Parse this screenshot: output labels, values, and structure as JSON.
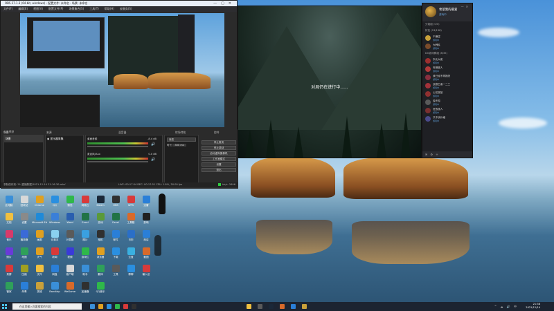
{
  "obs": {
    "title": "OBS 27.1.3 (64-bit, windows) - 配置文件: 未命名 - 场景: 未命名",
    "menu": [
      "文件(F)",
      "编辑(E)",
      "视图(V)",
      "配置文件(P)",
      "场景集合(S)",
      "工具(T)",
      "帮助(H)",
      "云服务(S)"
    ],
    "docks": {
      "scenes": "场景",
      "sources": "来源",
      "mixer": "混音器",
      "transitions": "转场特效",
      "controls": "控件"
    },
    "scene_item": "场景",
    "source_item": "显示器采集",
    "preview_label": "未选择源",
    "mixer_tracks": [
      {
        "name": "桌面音频",
        "db": "-8.4 dB"
      },
      {
        "name": "麦克风/Aux",
        "db": "0.0 dB"
      }
    ],
    "transition": {
      "type": "渐变",
      "duration_label": "时长",
      "duration": "300 ms"
    },
    "controls": [
      "停止推流",
      "停止录制",
      "启动虚拟摄像机",
      "工作室模式",
      "设置",
      "退出"
    ],
    "status": "录制保存到: 'D:/直播数据/2021-12-14 21-16-30.mkv'",
    "status_live": "LIVE: 00:17:54  REC: 00:17:51  CPU: 1.8%, 30.00 fps",
    "status_kbps": "kb/s: 2696"
  },
  "game": {
    "message": "对局仍在进行中......"
  },
  "chat": {
    "name": "希望我的最爱",
    "sub": "游戏中",
    "sections": [
      {
        "label": "分组组 (0/0)"
      },
      {
        "label": "好友 (13/138)"
      },
      {
        "label": "DG游戏群组 (8/35)"
      }
    ],
    "users": [
      {
        "name": "干燥涩",
        "status": "游戏中",
        "color": "#c8a03a"
      },
      {
        "name": "大韩民",
        "status": "游戏中",
        "color": "#7a4b2a"
      },
      {
        "name": "东北大佬",
        "status": "游戏中",
        "color": "#9c2f2f"
      },
      {
        "name": "炸弹超人",
        "status": "游戏中",
        "color": "#b03a3a"
      },
      {
        "name": "我已经不再抱怨",
        "status": "游戏中",
        "color": "#8a2f3f"
      },
      {
        "name": "战狼王者一二三",
        "status": "游戏中",
        "color": "#a2323a"
      },
      {
        "name": "心花怒放",
        "status": "游戏中",
        "color": "#903030"
      },
      {
        "name": "独不孤",
        "status": "游戏中",
        "color": "#5a5a5a"
      },
      {
        "name": "狂放旅人",
        "status": "游戏中",
        "color": "#7a3030"
      },
      {
        "name": "只不谈价格",
        "status": "游戏中",
        "color": "#4a4a8a"
      }
    ]
  },
  "desktop_icons": [
    {
      "label": "此电脑",
      "color": "#3a8fd8"
    },
    {
      "label": "回收站",
      "color": "#d8d8d8"
    },
    {
      "label": "Chrome",
      "color": "#e0a020"
    },
    {
      "label": "QQ",
      "color": "#2a8fe0"
    },
    {
      "label": "微信",
      "color": "#2fb84a"
    },
    {
      "label": "网易云",
      "color": "#d83a3a"
    },
    {
      "label": "Steam",
      "color": "#1b2838"
    },
    {
      "label": "OBS",
      "color": "#303030"
    },
    {
      "label": "WPS",
      "color": "#d83a3a"
    },
    {
      "label": "迅雷",
      "color": "#2a7fd8"
    },
    {
      "label": "文档",
      "color": "#f0c040"
    },
    {
      "label": "设置",
      "color": "#8a8a8a"
    },
    {
      "label": "Microsoft Edge",
      "color": "#1f8ad8"
    },
    {
      "label": "Windows",
      "color": "#3a7fd8"
    },
    {
      "label": "Word",
      "color": "#2a5faf"
    },
    {
      "label": "Excel",
      "color": "#217346"
    },
    {
      "label": "游戏",
      "color": "#5a9a3a"
    },
    {
      "label": "Excel",
      "color": "#217346"
    },
    {
      "label": "工具箱",
      "color": "#d86a2a"
    },
    {
      "label": "剪映",
      "color": "#202020"
    },
    {
      "label": "音乐",
      "color": "#d83a6a"
    },
    {
      "label": "播放器",
      "color": "#3a6ad8"
    },
    {
      "label": "画图",
      "color": "#e0a020"
    },
    {
      "label": "记事本",
      "color": "#8ad0f0"
    },
    {
      "label": "计算器",
      "color": "#5a5a5a"
    },
    {
      "label": "图片",
      "color": "#3aa0e0"
    },
    {
      "label": "相机",
      "color": "#303030"
    },
    {
      "label": "邮件",
      "color": "#2a7fd8"
    },
    {
      "label": "日历",
      "color": "#2a6fc8"
    },
    {
      "label": "商店",
      "color": "#2a7fd8"
    },
    {
      "label": "照片",
      "color": "#6a3ad8"
    },
    {
      "label": "地图",
      "color": "#2fa05a"
    },
    {
      "label": "天气",
      "color": "#e0a020"
    },
    {
      "label": "新闻",
      "color": "#d83a3a"
    },
    {
      "label": "视频",
      "color": "#3a3ad8"
    },
    {
      "label": "游戏栏",
      "color": "#2fb84a"
    },
    {
      "label": "浏览器",
      "color": "#e0a020"
    },
    {
      "label": "下载",
      "color": "#2a8fe0"
    },
    {
      "label": "云盘",
      "color": "#3ab0e0"
    },
    {
      "label": "截图",
      "color": "#d86a2a"
    },
    {
      "label": "录屏",
      "color": "#d83a3a"
    },
    {
      "label": "压缩",
      "color": "#a0a020"
    },
    {
      "label": "文件",
      "color": "#f0c040"
    },
    {
      "label": "网盘",
      "color": "#2a7fd8"
    },
    {
      "label": "客户端",
      "color": "#d8d8d8"
    },
    {
      "label": "助手",
      "color": "#3a8fd8"
    },
    {
      "label": "翻译",
      "color": "#2fa05a"
    },
    {
      "label": "工具",
      "color": "#5a5a5a"
    },
    {
      "label": "群聊",
      "color": "#2a8fe0"
    },
    {
      "label": "输入法",
      "color": "#d83a3a"
    },
    {
      "label": "管家",
      "color": "#2fa05a"
    },
    {
      "label": "杀毒",
      "color": "#2a7fd8"
    },
    {
      "label": "英雄",
      "color": "#c8a03a"
    },
    {
      "label": "Bandizip",
      "color": "#3a8fd8"
    },
    {
      "label": "WeGame",
      "color": "#d86a2a"
    },
    {
      "label": "加速器",
      "color": "#303030"
    },
    {
      "label": "QQ音乐",
      "color": "#2fb84a"
    }
  ],
  "taskbar": {
    "search_placeholder": "在这里输入你要搜索的内容",
    "time": "21:38",
    "date": "2021/12/14",
    "apps": [
      "#3a8fd8",
      "#e0a020",
      "#2a8fe0",
      "#2fb84a",
      "#d83a3a",
      "#303030",
      "#f0c040",
      "#5a5a5a",
      "#1b2838",
      "#d86a2a",
      "#2a7fd8",
      "#c8a03a"
    ]
  },
  "colors": {
    "obs_bg": "#2b2b2b",
    "live_indicator": "#2ecc40",
    "taskbar_bg": "#1c2431"
  }
}
